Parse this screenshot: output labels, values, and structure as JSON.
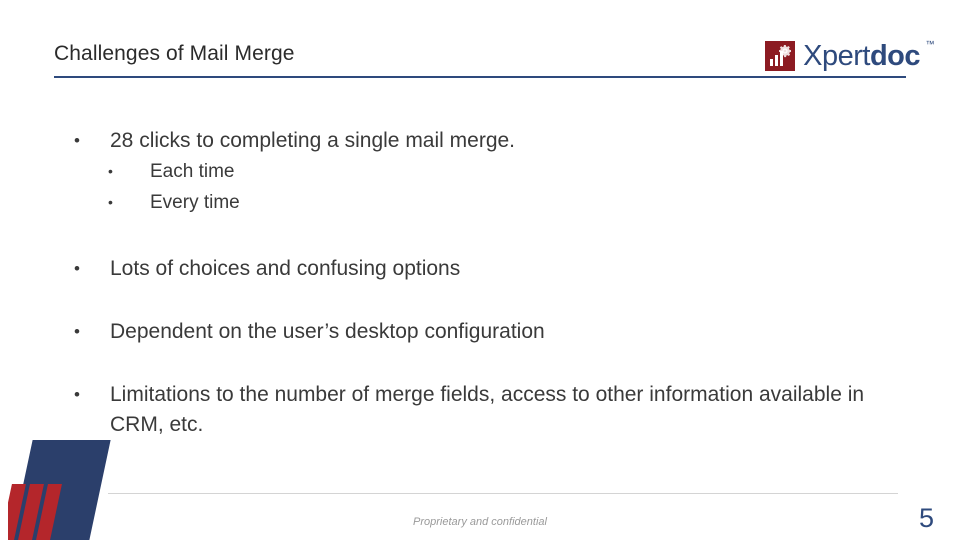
{
  "slide": {
    "title": "Challenges of Mail Merge",
    "accent_color": "#2e4a7d",
    "logo": {
      "icon_name": "xpertdoc-logo-mark",
      "word_part1": "Xpert",
      "word_part2": "doc",
      "trademark": "™"
    },
    "bullets": [
      {
        "level": 1,
        "marker": "•",
        "text": "28 clicks to completing a single mail merge."
      },
      {
        "level": 2,
        "marker": "•",
        "text": "Each time"
      },
      {
        "level": 2,
        "marker": "•",
        "text": "Every time"
      },
      {
        "level": 1,
        "marker": "•",
        "text": "Lots of choices and confusing options"
      },
      {
        "level": 1,
        "marker": "•",
        "text": "Dependent on the user’s desktop configuration"
      },
      {
        "level": 1,
        "marker": "•",
        "text": "Limitations to the number of merge fields, access to other information available in CRM, etc."
      }
    ],
    "footer": {
      "note": "Proprietary and confidential",
      "page_number": "5"
    }
  }
}
